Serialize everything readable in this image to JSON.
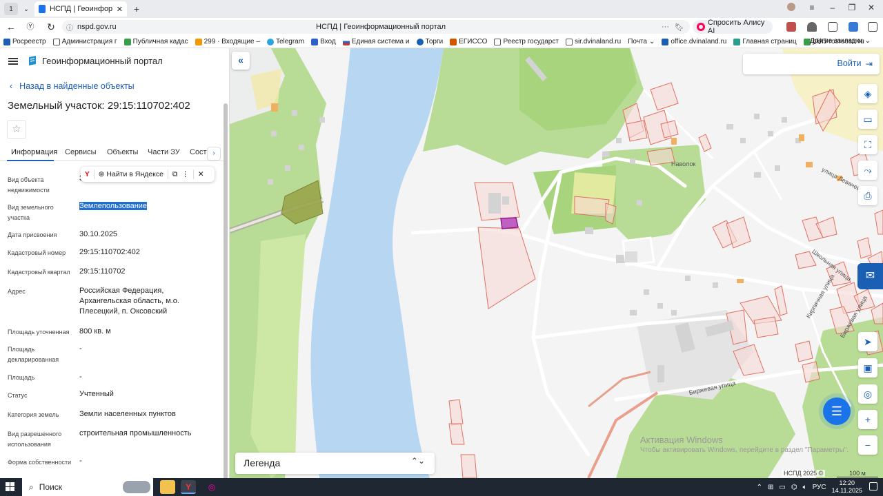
{
  "browser": {
    "tab_count": "1",
    "tab_title": "НСПД | Геоинформацион",
    "url_host": "nspd.gov.ru",
    "page_title": "НСПД | Геоинформационный портал",
    "alice_label": "Спросить Алису AI",
    "bookmarks": [
      {
        "label": "Росреестр",
        "color": "#1a5fb4"
      },
      {
        "label": "Администрация г",
        "color": "#555"
      },
      {
        "label": "Публичная кадас",
        "color": "#3a9d4a"
      },
      {
        "label": "299 · Входящие –",
        "color": "#f29900"
      },
      {
        "label": "Telegram",
        "color": "#2aa3df"
      },
      {
        "label": "Вход",
        "color": "#2a62c9"
      },
      {
        "label": "Единая система и",
        "color": "#c0392b"
      },
      {
        "label": "Торги",
        "color": "#1a5fb4"
      },
      {
        "label": "ЕГИССО",
        "color": "#d35400"
      },
      {
        "label": "Реестр государст",
        "color": "#555"
      },
      {
        "label": "sir.dvinaland.ru",
        "color": "#555"
      },
      {
        "label": "Почта",
        "color": "#fff"
      },
      {
        "label": "office.dvinaland.ru",
        "color": "#1a5fb4"
      },
      {
        "label": "Главная страниц",
        "color": "#2a9d8f"
      },
      {
        "label": "pkk5 rosreestr ru",
        "color": "#3a9d4a"
      }
    ],
    "other_bookmarks": "Другие закладки"
  },
  "panel": {
    "portal_name": "Геоинформационный портал",
    "back_link": "Назад в найденные объекты",
    "title": "Земельный участок: 29:15:110702:402",
    "tabs": [
      "Информация",
      "Сервисы",
      "Объекты",
      "Части ЗУ",
      "Соста"
    ],
    "popup": {
      "search": "Найти в Яндексе"
    },
    "fields": [
      {
        "label": "Вид объекта недвижимости",
        "value": "З"
      },
      {
        "label": "Вид земельного участка",
        "value": "Землепользование"
      },
      {
        "label": "Дата присвоения",
        "value": "30.10.2025"
      },
      {
        "label": "Кадастровый номер",
        "value": "29:15:110702:402"
      },
      {
        "label": "Кадастровый квартал",
        "value": "29:15:110702"
      },
      {
        "label": "Адрес",
        "value": "Российская Федерация, Архангельская область, м.о. Плесецкий, п. Оксовский"
      },
      {
        "label": "Площадь уточненная",
        "value": "800 кв. м"
      },
      {
        "label": "Площадь декларированная",
        "value": "-"
      },
      {
        "label": "Площадь",
        "value": "-"
      },
      {
        "label": "Статус",
        "value": "Учтенный"
      },
      {
        "label": "Категория земель",
        "value": "Земли населенных пунктов"
      },
      {
        "label": "Вид разрешенного использования",
        "value": "строительная промышленность"
      },
      {
        "label": "Форма собственности",
        "value": "-"
      }
    ]
  },
  "map": {
    "login": "Войти",
    "legend": "Легенда",
    "streets": {
      "naboloka": "Наволок",
      "levacheva": "улица Левачева",
      "shkolnaya": "Школьная улица",
      "kirpichnaya": "Кирпичная улица",
      "birzhevaya_v": "Биржевая улица",
      "birzhevaya_h": "Биржевая улица"
    },
    "activation_title": "Активация Windows",
    "activation_text": "Чтобы активировать Windows, перейдите в раздел \"Параметры\".",
    "copyright": "НСПД 2025 ©",
    "scale": "100 м"
  },
  "taskbar": {
    "search": "Поиск",
    "lang": "РУС",
    "time": "12:20",
    "date": "14.11.2025"
  }
}
